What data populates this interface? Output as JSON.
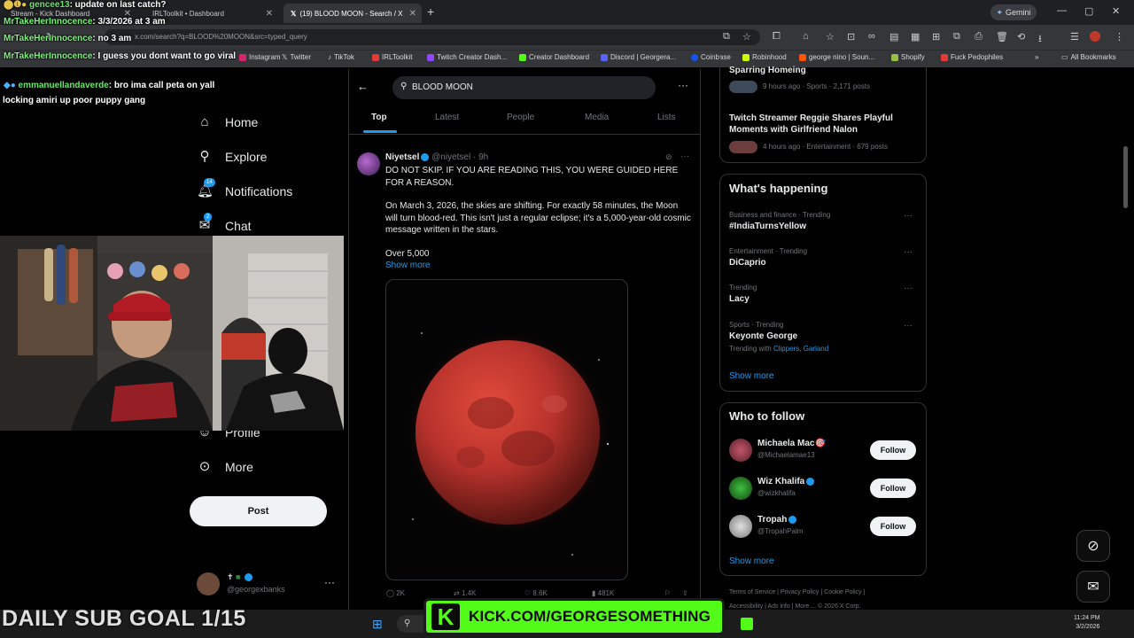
{
  "browser": {
    "tabs": [
      {
        "label": "Stream - Kick Dashboard"
      },
      {
        "label": "IRLToolkit • Dashboard"
      },
      {
        "label": "(19) BLOOD MOON - Search / X"
      }
    ],
    "gemini_label": "Gemini",
    "url": "x.com/search?q=BLOOD%20MOON&src=typed_query",
    "bookmarks": [
      "Instagram",
      "Twitter",
      "TikTok",
      "IRLToolkit",
      "Twitch Creator Dash...",
      "Creator Dashboard",
      "Discord | Georgera...",
      "Coinbase",
      "Robinhood",
      "george nino | Soun...",
      "Shopify",
      "Fuck Pedophiles"
    ],
    "all_bookmarks": "All Bookmarks"
  },
  "chat": [
    {
      "user": "gencee13",
      "msg": ": update on last catch?"
    },
    {
      "user": "MrTakeHerInnocence",
      "msg": ": 3/3/2026 at 3 am"
    },
    {
      "user": "MrTakeHerInnocence",
      "msg": ": no 3 am"
    },
    {
      "user": "MrTakeHerInnocence",
      "msg": ": I guess you dont want to go viral"
    },
    {
      "user": "emmanuellandaverde",
      "msg": ": bro ima call peta on yall",
      "cont": "locking amiri up poor puppy gang"
    }
  ],
  "sidebar": {
    "items": [
      {
        "label": "Home"
      },
      {
        "label": "Explore"
      },
      {
        "label": "Notifications",
        "badge": "14"
      },
      {
        "label": "Chat",
        "badge": "2"
      },
      {
        "label": "Profile"
      },
      {
        "label": "More"
      }
    ],
    "post_label": "Post",
    "account_handle": "@georgexbanks"
  },
  "search": {
    "query": "BLOOD MOON",
    "tabs": [
      "Top",
      "Latest",
      "People",
      "Media",
      "Lists"
    ]
  },
  "tweet": {
    "name": "Niyetsel",
    "handle": "@niyetsel",
    "time": "9h",
    "p1": "DO NOT SKIP. IF YOU ARE READING THIS, YOU WERE GUIDED HERE FOR A REASON.",
    "p2": "On March 3, 2026, the skies are shifting. For exactly 58 minutes, the Moon will turn blood-red. This isn't just a regular eclipse; it's a 5,000-year-old cosmic message written in the stars.",
    "p3": "Over 5,000",
    "show_more": "Show more",
    "replies": "2K",
    "reposts": "1.4K",
    "likes": "8.6K",
    "views": "481K"
  },
  "right": {
    "top_trend_title": "Sparring Homeing",
    "top_trend_meta": "9 hours ago · Sports · 2,171 posts",
    "news": {
      "title": "Twitch Streamer Reggie Shares Playful Moments with Girlfriend Nalon",
      "meta": "4 hours ago · Entertainment · 679 posts"
    },
    "happening_title": "What's happening",
    "trends": [
      {
        "meta": "Business and finance · Trending",
        "name": "#IndiaTurnsYellow"
      },
      {
        "meta": "Entertainment · Trending",
        "name": "DiCaprio"
      },
      {
        "meta": "Trending",
        "name": "Lacy"
      },
      {
        "meta": "Sports · Trending",
        "name": "Keyonte George",
        "with_prefix": "Trending with ",
        "with": "Clippers, Garland"
      }
    ],
    "show_more": "Show more",
    "wtf_title": "Who to follow",
    "follow_label": "Follow",
    "follows": [
      {
        "name": "Michaela Mac🎯",
        "handle": "@Michaelamae13"
      },
      {
        "name": "Wiz Khalifa",
        "handle": "@wizkhalifa"
      },
      {
        "name": "Tropah",
        "handle": "@TropahPalm"
      }
    ],
    "footer": [
      "Terms of Service",
      "Privacy Policy",
      "Cookie Policy",
      "Accessibility",
      "Ads info",
      "More ...",
      "© 2026 X Corp."
    ]
  },
  "overlay": {
    "sub_goal": "DAILY SUB GOAL 1/15",
    "kick_url": "KICK.COM/GEORGESOMETHING",
    "time": "11:24 PM",
    "date": "3/2/2026"
  },
  "colors": {
    "accent": "#1d9bf0",
    "kick_green": "#53fc18",
    "moon": "#b8322c"
  }
}
